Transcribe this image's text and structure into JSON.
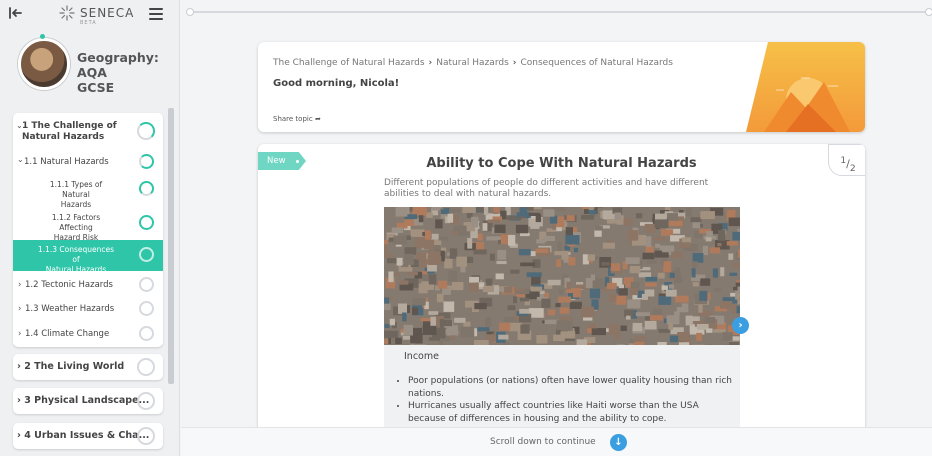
{
  "app": {
    "logo_text": "SENECA",
    "logo_badge": "BETA"
  },
  "subject": {
    "title_line1": "Geography: AQA",
    "title_line2": "GCSE"
  },
  "sidebar": {
    "chapter1": {
      "label": "1 The Challenge of Natural Hazards",
      "topic": "1.1 Natural Hazards",
      "subtopics": [
        {
          "label_line1": "1.1.1 Types of Natural",
          "label_line2": "Hazards"
        },
        {
          "label_line1": "1.1.2 Factors Affecting",
          "label_line2": "Hazard Risk"
        },
        {
          "label_line1": "1.1.3 Consequences of",
          "label_line2": "Natural Hazards"
        }
      ],
      "topics": [
        {
          "label": "1.2 Tectonic Hazards"
        },
        {
          "label": "1.3 Weather Hazards"
        },
        {
          "label": "1.4 Climate Change"
        }
      ]
    },
    "chapters": [
      {
        "label": "2 The Living World"
      },
      {
        "label": "3 Physical Landscape..."
      },
      {
        "label": "4 Urban Issues & Cha..."
      }
    ]
  },
  "header": {
    "breadcrumb": [
      "The Challenge of Natural Hazards",
      "Natural Hazards",
      "Consequences of Natural Hazards"
    ],
    "greeting": "Good morning, Nicola!",
    "share": "Share topic"
  },
  "card": {
    "tag": "New",
    "page_current": "1",
    "page_total": "2",
    "title": "Ability to Cope With Natural Hazards",
    "description": "Different populations of people do different activities and have different abilities to deal with natural hazards.",
    "image_label": "Income",
    "bullets": [
      "Poor populations (or nations) often have lower quality housing than rich nations.",
      "Hurricanes usually affect countries like Haiti worse than the USA because of differences in housing and the ability to cope."
    ]
  },
  "footer": {
    "scroll_text": "Scroll down to continue"
  },
  "colors": {
    "accent": "#2fc5a8",
    "blue": "#3b9ee0"
  }
}
